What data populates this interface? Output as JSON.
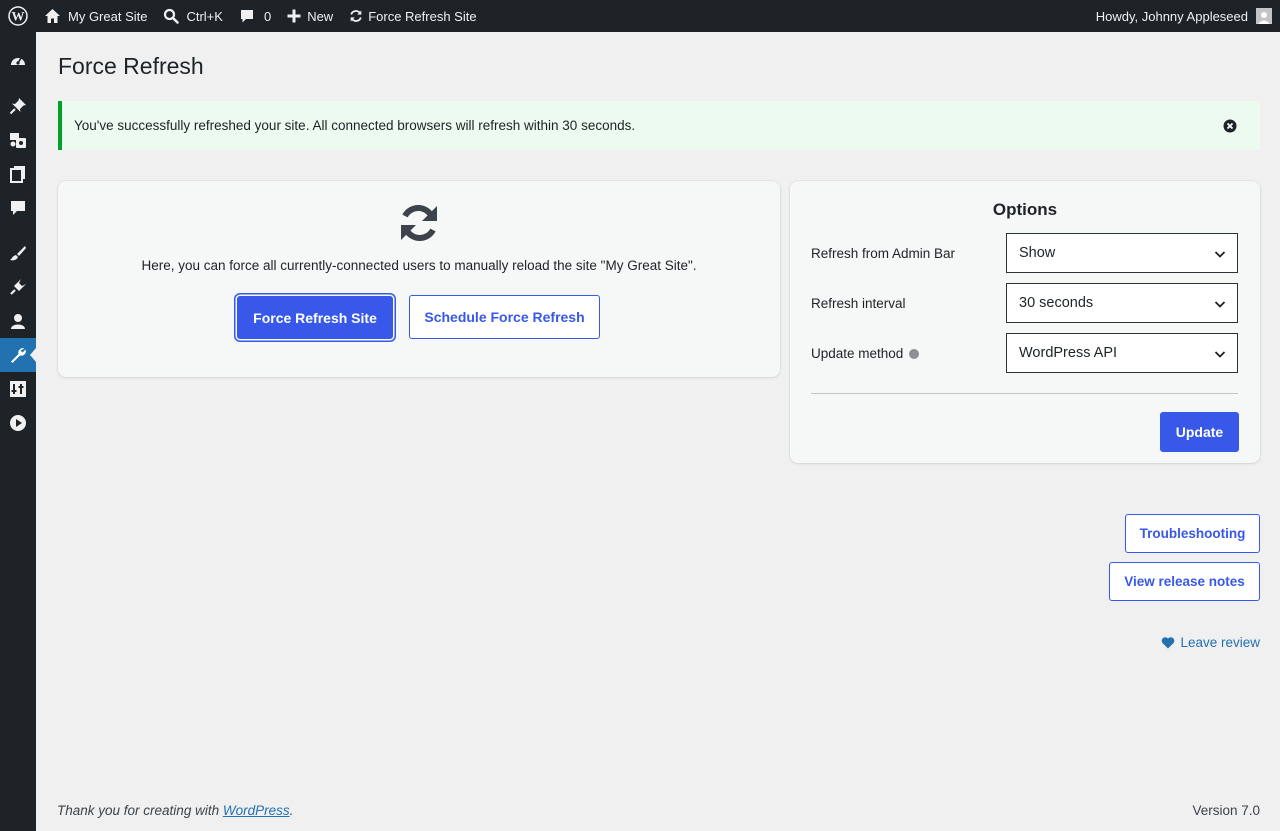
{
  "admin_bar": {
    "site_name": "My Great Site",
    "search_shortcut": "Ctrl+K",
    "comments_count": "0",
    "new_label": "New",
    "force_refresh_label": "Force Refresh Site",
    "greeting": "Howdy, Johnny Appleseed"
  },
  "sidebar": {
    "items": [
      {
        "icon": "dashboard-icon"
      },
      {
        "icon": "posts-icon"
      },
      {
        "icon": "media-icon"
      },
      {
        "icon": "pages-icon"
      },
      {
        "icon": "comments-icon"
      },
      {
        "icon": "appearance-icon"
      },
      {
        "icon": "plugins-icon"
      },
      {
        "icon": "users-icon"
      },
      {
        "icon": "tools-icon",
        "current": true
      },
      {
        "icon": "settings-icon"
      },
      {
        "icon": "play-icon"
      }
    ]
  },
  "page": {
    "title": "Force Refresh"
  },
  "notice": {
    "message": "You've successfully refreshed your site. All connected browsers will refresh within 30 seconds."
  },
  "main_card": {
    "description": "Here, you can force all currently-connected users to manually reload the site \"My Great Site\".",
    "force_refresh_button": "Force Refresh Site",
    "schedule_button": "Schedule Force Refresh"
  },
  "options": {
    "title": "Options",
    "admin_bar_label": "Refresh from Admin Bar",
    "admin_bar_value": "Show",
    "interval_label": "Refresh interval",
    "interval_value": "30 seconds",
    "method_label": "Update method",
    "method_value": "WordPress API",
    "update_button": "Update"
  },
  "links": {
    "troubleshooting": "Troubleshooting",
    "release_notes": "View release notes",
    "leave_review": "Leave review"
  },
  "footer": {
    "thanks_prefix": "Thank you for creating with ",
    "wordpress_link": "WordPress",
    "thanks_suffix": ".",
    "version": "Version 7.0"
  },
  "colors": {
    "admin_bar_bg": "#1d2327",
    "accent": "#3858e9",
    "link": "#2271b1",
    "notice_border": "#00a32a",
    "notice_bg": "#edfaef",
    "page_bg": "#f0f0f1"
  }
}
